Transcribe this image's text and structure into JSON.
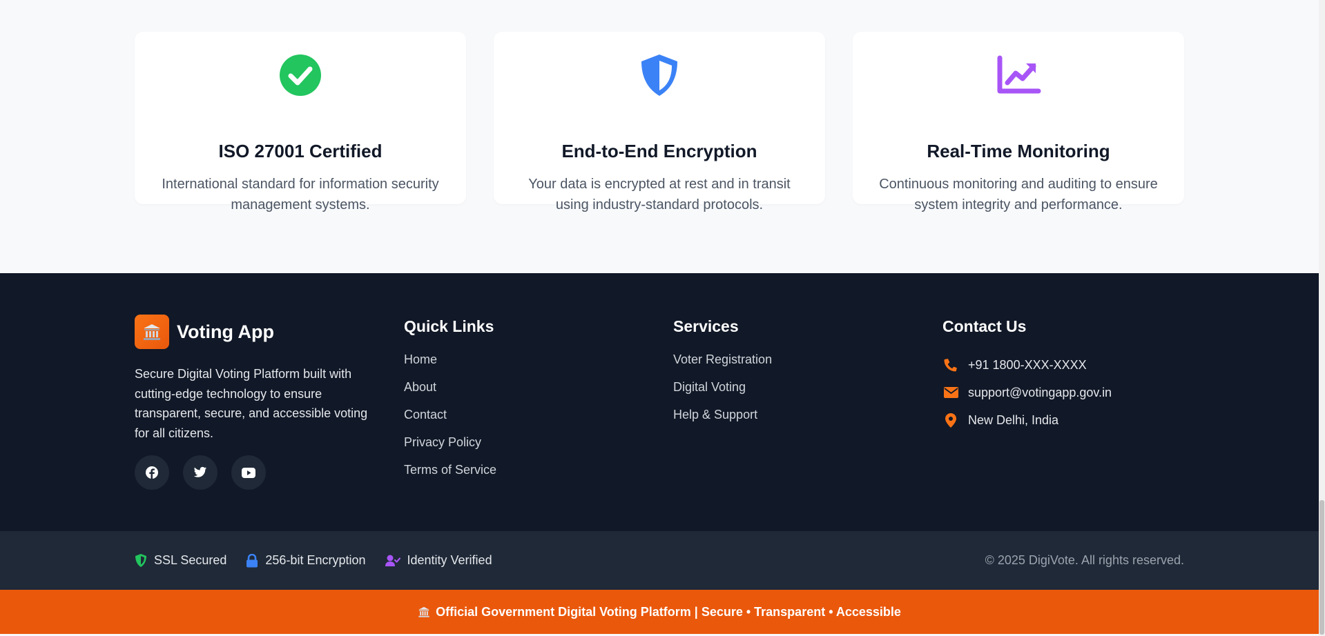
{
  "features": [
    {
      "title": "ISO 27001 Certified",
      "desc": "International standard for information security management systems.",
      "icon": "check-circle-icon",
      "color": "#22c55e"
    },
    {
      "title": "End-to-End Encryption",
      "desc": "Your data is encrypted at rest and in transit using industry-standard protocols.",
      "icon": "shield-icon",
      "color": "#3b82f6"
    },
    {
      "title": "Real-Time Monitoring",
      "desc": "Continuous monitoring and auditing to ensure system integrity and performance.",
      "icon": "chart-line-icon",
      "color": "#a855f7"
    }
  ],
  "footer": {
    "brand": {
      "name": "Voting App",
      "logo_icon": "landmark-icon",
      "description": "Secure Digital Voting Platform built with cutting-edge technology to ensure transparent, secure, and accessible voting for all citizens."
    },
    "socials": [
      "facebook-icon",
      "twitter-icon",
      "youtube-icon"
    ],
    "quick_links": {
      "title": "Quick Links",
      "items": [
        "Home",
        "About",
        "Contact",
        "Privacy Policy",
        "Terms of Service"
      ]
    },
    "services": {
      "title": "Services",
      "items": [
        "Voter Registration",
        "Digital Voting",
        "Help & Support"
      ]
    },
    "contact": {
      "title": "Contact Us",
      "phone": "+91 1800-XXX-XXXX",
      "email": "support@votingapp.gov.in",
      "location": "New Delhi, India",
      "accent": "#f97316"
    }
  },
  "subfooter": {
    "badges": [
      {
        "label": "SSL Secured",
        "icon": "shield-icon",
        "color": "#22c55e"
      },
      {
        "label": "256-bit Encryption",
        "icon": "lock-icon",
        "color": "#3b82f6"
      },
      {
        "label": "Identity Verified",
        "icon": "user-check-icon",
        "color": "#a855f7"
      }
    ],
    "copyright": "© 2025 DigiVote. All rights reserved."
  },
  "banner": {
    "text": "Official Government Digital Voting Platform | Secure • Transparent • Accessible",
    "icon": "landmark-icon",
    "color": "#ea580c"
  }
}
